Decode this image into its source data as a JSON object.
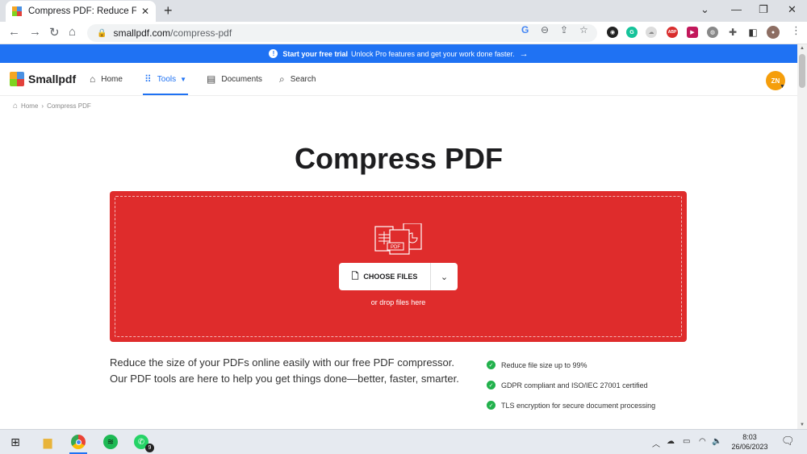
{
  "browser": {
    "tab_title": "Compress PDF: Reduce File Size O",
    "url_domain": "smallpdf.com",
    "url_path": "/compress-pdf",
    "new_tab_label": "+",
    "extensions": [
      {
        "name": "google-icon",
        "label": "G"
      },
      {
        "name": "zoom-icon",
        "label": ""
      },
      {
        "name": "grammarly-icon",
        "label": "G",
        "color": "#15c39a"
      },
      {
        "name": "adblock-icon",
        "label": "ABP",
        "color": "#d92d2d"
      }
    ]
  },
  "banner": {
    "bold": "Start your free trial",
    "text": "Unlock Pro features and get your work done faster."
  },
  "header": {
    "logo": "Smallpdf",
    "nav": [
      {
        "label": "Home"
      },
      {
        "label": "Tools"
      },
      {
        "label": "Documents"
      },
      {
        "label": "Search"
      }
    ],
    "avatar_initials": "ZN"
  },
  "breadcrumb": {
    "home": "Home",
    "separator": "›",
    "current": "Compress PDF"
  },
  "main": {
    "title": "Compress PDF",
    "choose_files": "CHOOSE FILES",
    "drop_hint": "or drop files here",
    "doc_badge": "PDF",
    "description": "Reduce the size of your PDFs online easily with our free PDF compressor. Our PDF tools are here to help you get things done—better, faster, smarter.",
    "features": [
      "Reduce file size up to 99%",
      "GDPR compliant and ISO/IEC 27001 certified",
      "TLS encryption for secure document processing"
    ]
  },
  "taskbar": {
    "time": "8:03",
    "date": "26/06/2023",
    "whatsapp_badge": "9"
  },
  "colors": {
    "accent": "#1f72f3",
    "dropzone": "#df2c2c",
    "check": "#22b14c",
    "avatar": "#f59e0b"
  }
}
